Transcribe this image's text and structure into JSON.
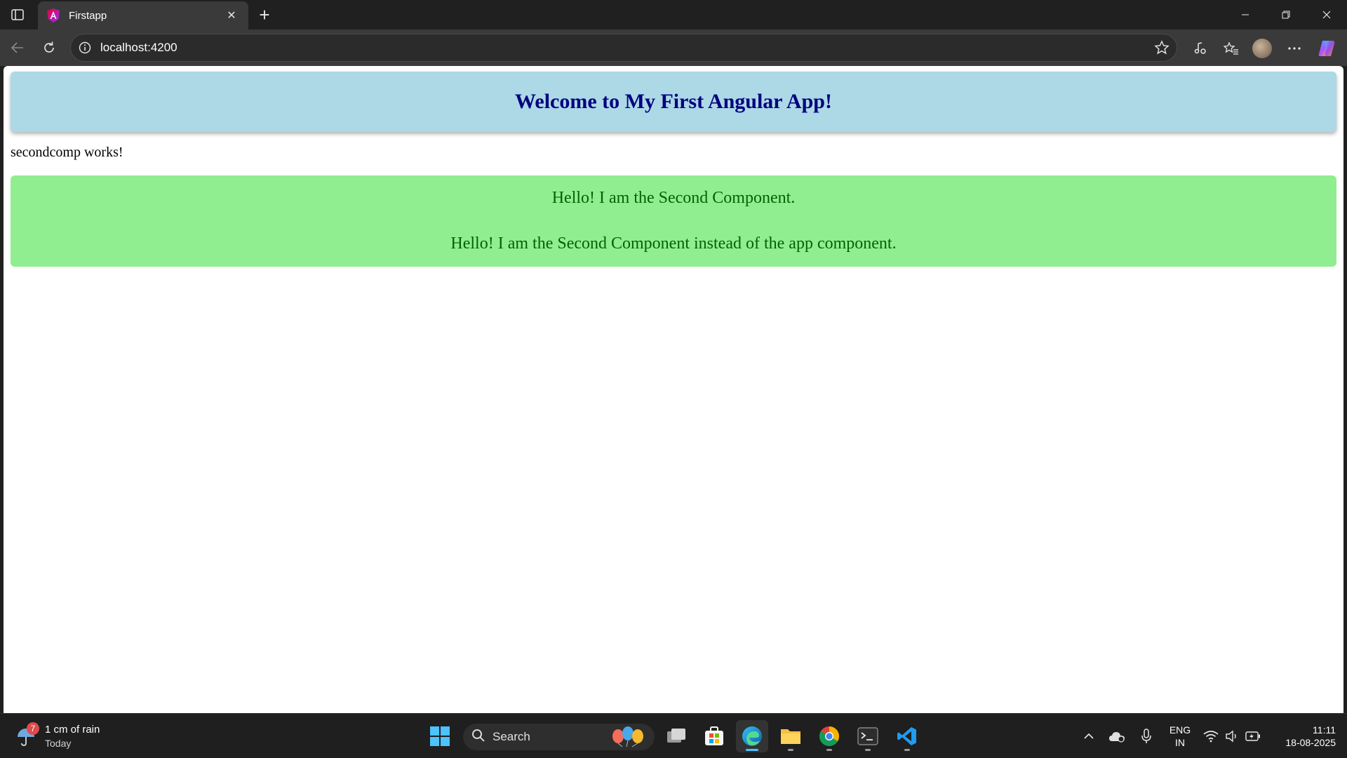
{
  "browser": {
    "tab_title": "Firstapp",
    "new_tab_symbol": "+",
    "close_symbol": "✕",
    "url": "localhost:4200"
  },
  "page": {
    "header_title": "Welcome to My First Angular App!",
    "secondcomp_text": "secondcomp works!",
    "message_1": "Hello! I am the Second Component.",
    "message_2": "Hello! I am the Second Component instead of the app component."
  },
  "taskbar": {
    "weather_badge": "7",
    "weather_line1": "1 cm of rain",
    "weather_line2": "Today",
    "search_label": "Search",
    "lang_line1": "ENG",
    "lang_line2": "IN",
    "time": "11:11",
    "date": "18-08-2025"
  },
  "colors": {
    "header_bg": "#add8e6",
    "header_text": "#000080",
    "message_bg": "#90ee90",
    "message_text": "#006400"
  }
}
